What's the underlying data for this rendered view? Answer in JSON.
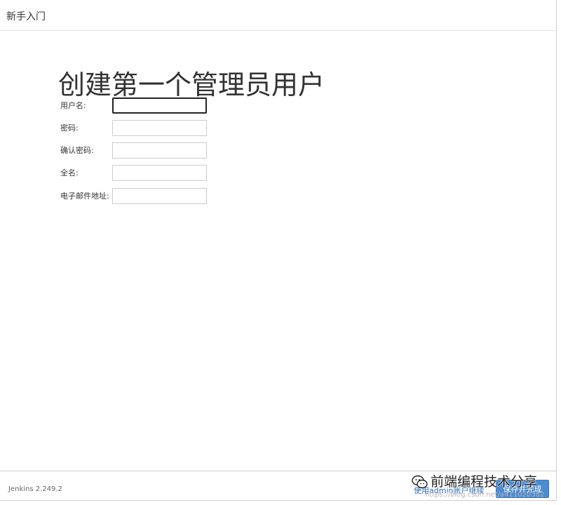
{
  "header": {
    "title": "新手入门"
  },
  "main": {
    "title": "创建第一个管理员用户",
    "fields": [
      {
        "label": "用户名:",
        "value": ""
      },
      {
        "label": "密码:",
        "value": ""
      },
      {
        "label": "确认密码:",
        "value": ""
      },
      {
        "label": "全名:",
        "value": ""
      },
      {
        "label": "电子邮件地址:",
        "value": ""
      }
    ]
  },
  "footer": {
    "version": "Jenkins 2.249.2",
    "skip_label": "使用admin账户继续",
    "save_label": "保存并完成"
  },
  "watermark": {
    "text": "前端编程技术分享",
    "url": "https://blog.csdn.net/a411020382"
  },
  "colors": {
    "primary_button": "#4b8bd0",
    "link": "#2a6ebb"
  }
}
